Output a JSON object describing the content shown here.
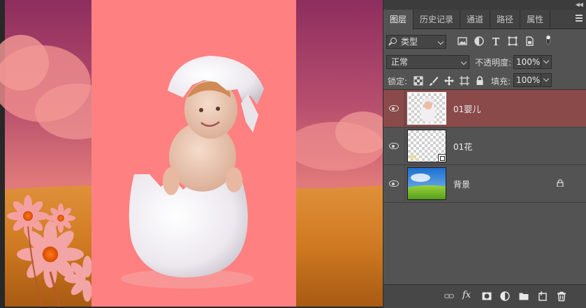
{
  "panel": {
    "tabs": [
      {
        "label": "图层",
        "active": true
      },
      {
        "label": "历史记录",
        "active": false
      },
      {
        "label": "通道",
        "active": false
      },
      {
        "label": "路径",
        "active": false
      },
      {
        "label": "属性",
        "active": false
      }
    ],
    "filter": {
      "value": "类型",
      "icons": [
        "image-filter-icon",
        "adjustment-filter-icon",
        "type-filter-icon",
        "shape-filter-icon",
        "smartobject-filter-icon",
        "filter-toggle-icon"
      ]
    },
    "blend_mode": "正常",
    "opacity": {
      "label": "不透明度:",
      "value": "100%"
    },
    "lock": {
      "label": "锁定:",
      "icons": [
        "lock-transparent-icon",
        "lock-paint-icon",
        "lock-position-icon",
        "lock-artboard-icon",
        "lock-all-icon"
      ]
    },
    "fill": {
      "label": "填充:",
      "value": "100%"
    },
    "layers": [
      {
        "name": "01婴儿",
        "selected": true,
        "visible": true,
        "thumbnail": "baby-thumbnail",
        "smart_object": false,
        "locked": false
      },
      {
        "name": "01花",
        "selected": false,
        "visible": true,
        "thumbnail": "flower-thumbnail",
        "smart_object": true,
        "locked": false
      },
      {
        "name": "背景",
        "selected": false,
        "visible": true,
        "thumbnail": "landscape-thumbnail",
        "smart_object": false,
        "locked": true
      }
    ],
    "bottom_icons": [
      "link-layers-icon",
      "fx-icon",
      "add-mask-icon",
      "adjustment-layer-icon",
      "new-group-icon",
      "new-layer-icon",
      "delete-layer-icon"
    ],
    "fx_label": "fx"
  },
  "colors": {
    "panel_bg": "#535353",
    "selected_layer": "#8a4a4a",
    "canvas_pink": "#ff8080"
  }
}
